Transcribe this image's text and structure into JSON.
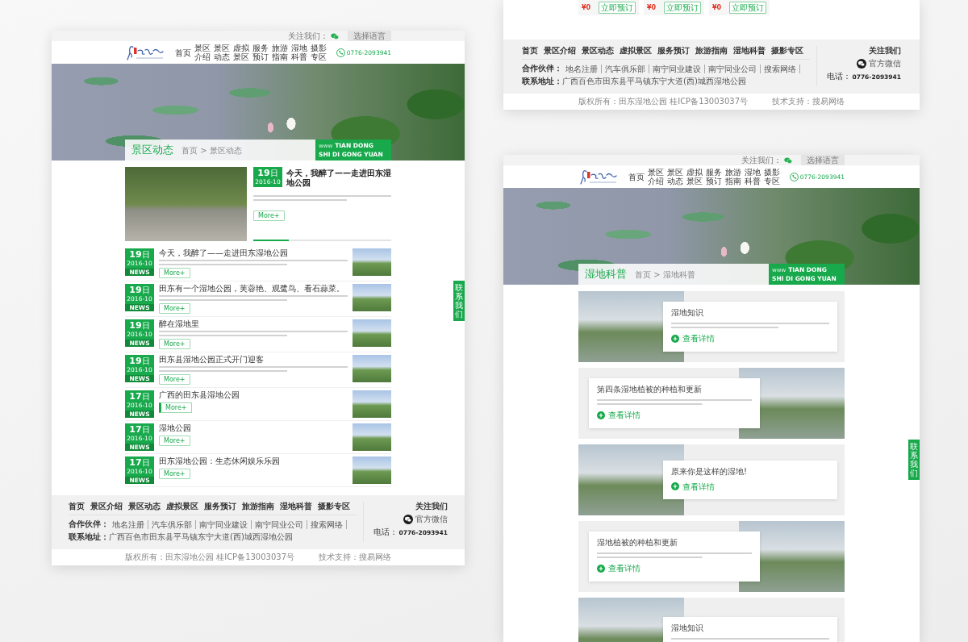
{
  "pages": [
    {
      "kind": "news_list",
      "top_bar": {
        "follow": "关注我们：",
        "language": "选择语言"
      },
      "nav": [
        "首页",
        "景区介绍",
        "景区动态",
        "虚拟景区",
        "服务预订",
        "旅游指南",
        "湿地科普",
        "摄影专区"
      ],
      "phone": "0776-2093941",
      "banner": {
        "title": "景区动态",
        "breadcrumb": "首页 > 景区动态",
        "tag_prefix": "www",
        "tag_lines": [
          "TIAN DONG",
          "SHI DI GONG YUAN"
        ]
      },
      "featured": {
        "day": "19",
        "day_unit": "日",
        "month": "2016-10",
        "title": "今天，我醉了——走进田东湿地公园",
        "blurred_summary": true,
        "more": "More+",
        "level": 0.26
      },
      "news": [
        {
          "day": "19",
          "day_unit": "日",
          "month": "2016-10",
          "tag": "NEWS",
          "title": "今天，我醉了——走进田东湿地公园",
          "blurred_summary": true,
          "more": "More+",
          "hovered": false
        },
        {
          "day": "19",
          "day_unit": "日",
          "month": "2016-10",
          "tag": "NEWS",
          "title": "田东有一个湿地公园，芙蓉艳、观鹭鸟、看石蒜菜。",
          "blurred_summary": true,
          "more": "More+",
          "hovered": false
        },
        {
          "day": "19",
          "day_unit": "日",
          "month": "2016-10",
          "tag": "NEWS",
          "title": "醉在湿地里",
          "blurred_summary": true,
          "more": "More+",
          "hovered": false
        },
        {
          "day": "19",
          "day_unit": "日",
          "month": "2016-10",
          "tag": "NEWS",
          "title": "田东县湿地公园正式开门迎客",
          "blurred_summary": true,
          "more": "More+",
          "hovered": false
        },
        {
          "day": "17",
          "day_unit": "日",
          "month": "2016-10",
          "tag": "NEWS",
          "title": "广西的田东县湿地公园",
          "blurred_summary": false,
          "more": "More+",
          "hovered": true
        },
        {
          "day": "17",
          "day_unit": "日",
          "month": "2016-10",
          "tag": "NEWS",
          "title": "湿地公园",
          "blurred_summary": false,
          "more": "More+",
          "hovered": false
        },
        {
          "day": "17",
          "day_unit": "日",
          "month": "2016-10",
          "tag": "NEWS",
          "title": "田东湿地公园：生态休闲娱乐乐园",
          "blurred_summary": false,
          "more": "More+",
          "hovered": false
        }
      ],
      "side_tab": "联系我们",
      "footer": {
        "nav": [
          "首页",
          "景区介绍",
          "景区动态",
          "虚拟景区",
          "服务预订",
          "旅游指南",
          "湿地科普",
          "摄影专区"
        ],
        "partners_label": "合作伙伴：",
        "partners": [
          "地名注册",
          "汽车俱乐部",
          "南宁同业建设",
          "南宁同业公司",
          "搜索网络"
        ],
        "address_label": "联系地址：",
        "address": "广西百色市田东县平马镇东宁大道(西)城西湿地公园",
        "follow": "关注我们",
        "wechat": "官方微信",
        "phone_label": "电话：",
        "phone": "0776-2093941"
      },
      "bottom_bar": {
        "copyright": "版权所有：田东湿地公园 桂ICP备13003037号",
        "support": "技术支持：搜易网络"
      }
    },
    {
      "kind": "footer_view",
      "products": [
        {
          "price": "¥0",
          "button": "立即预订"
        },
        {
          "price": "¥0",
          "button": "立即预订"
        },
        {
          "price": "¥0",
          "button": "立即预订"
        }
      ],
      "footer": {
        "nav": [
          "首页",
          "景区介绍",
          "景区动态",
          "虚拟景区",
          "服务预订",
          "旅游指南",
          "湿地科普",
          "摄影专区"
        ],
        "partners_label": "合作伙伴：",
        "partners": [
          "地名注册",
          "汽车俱乐部",
          "南宁同业建设",
          "南宁同业公司",
          "搜索网络"
        ],
        "address_label": "联系地址：",
        "address": "广西百色市田东县平马镇东宁大道(西)城西湿地公园",
        "follow": "关注我们",
        "wechat": "官方微信",
        "phone_label": "电话：",
        "phone": "0776-2093941"
      },
      "bottom_bar": {
        "copyright": "版权所有：田东湿地公园 桂ICP备13003037号",
        "support": "技术支持：搜易网络"
      }
    },
    {
      "kind": "science_list",
      "top_bar": {
        "follow": "关注我们：",
        "language": "选择语言"
      },
      "nav": [
        "首页",
        "景区介绍",
        "景区动态",
        "虚拟景区",
        "服务预订",
        "旅游指南",
        "湿地科普",
        "摄影专区"
      ],
      "phone": "0776-2093941",
      "banner": {
        "title": "湿地科普",
        "breadcrumb": "首页 > 湿地科普",
        "tag_prefix": "www",
        "tag_lines": [
          "TIAN DONG",
          "SHI DI GONG YUAN"
        ]
      },
      "articles": [
        {
          "kind": "image_left",
          "title": "湿地知识",
          "blurred_summary": true,
          "link": "查看详情"
        },
        {
          "kind": "image_right",
          "title": "第四条湿地植被的种植和更新",
          "blurred_summary": true,
          "link": "查看详情"
        },
        {
          "kind": "image_left",
          "title": "原来你是这样的湿地!",
          "blurred_summary": false,
          "link": "查看详情"
        },
        {
          "kind": "image_right",
          "title": "湿地植被的种植和更新",
          "blurred_summary": true,
          "link": "查看详情"
        },
        {
          "kind": "image_left",
          "title": "湿地知识",
          "blurred_summary": true
        }
      ],
      "side_tab": "联系我们"
    }
  ]
}
